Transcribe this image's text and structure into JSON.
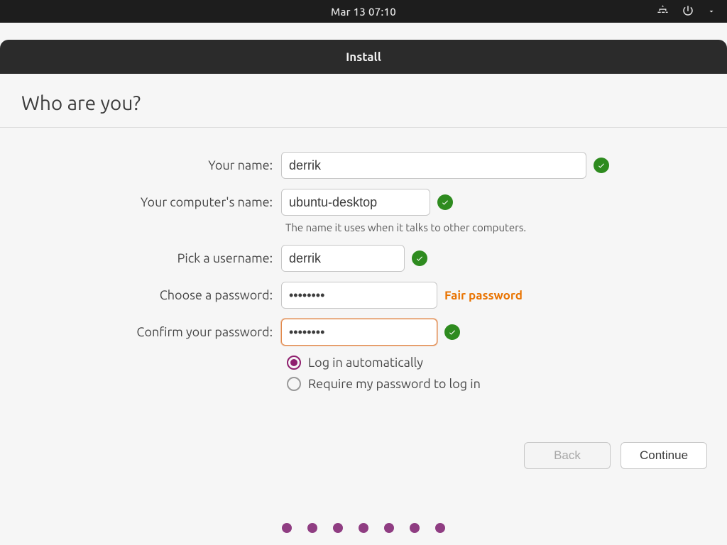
{
  "topbar": {
    "datetime": "Mar 13  07:10"
  },
  "window": {
    "title": "Install"
  },
  "page": {
    "title": "Who are you?"
  },
  "form": {
    "name": {
      "label": "Your name:",
      "value": "derrik"
    },
    "hostname": {
      "label": "Your computer's name:",
      "value": "ubuntu-desktop",
      "hint": "The name it uses when it talks to other computers."
    },
    "username": {
      "label": "Pick a username:",
      "value": "derrik"
    },
    "password": {
      "label": "Choose a password:",
      "value": "••••••••",
      "feedback": "Fair password"
    },
    "confirm": {
      "label": "Confirm your password:",
      "value": "••••••••"
    },
    "login_options": {
      "auto": "Log in automatically",
      "require": "Require my password to log in",
      "selected": "auto"
    }
  },
  "nav": {
    "back": "Back",
    "continue": "Continue"
  },
  "progress": {
    "total_dots": 7
  }
}
